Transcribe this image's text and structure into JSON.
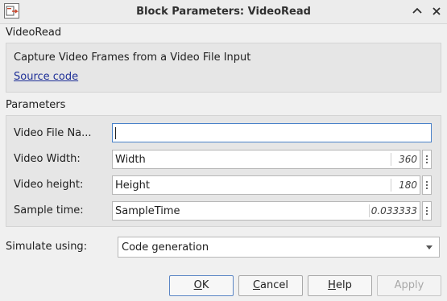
{
  "window": {
    "title": "Block Parameters: VideoRead"
  },
  "block": {
    "name": "VideoRead",
    "description": "Capture Video Frames from a Video File Input",
    "source_link": "Source code"
  },
  "parameters": {
    "heading": "Parameters",
    "rows": [
      {
        "label": "Video File Na...",
        "value": "",
        "suffix": ""
      },
      {
        "label": "Video Width:",
        "value": "Width",
        "suffix": "360"
      },
      {
        "label": "Video height:",
        "value": "Height",
        "suffix": "180"
      },
      {
        "label": "Sample time:",
        "value": "SampleTime",
        "suffix": "0.033333"
      }
    ]
  },
  "simulate": {
    "label": "Simulate using:",
    "selected": "Code generation"
  },
  "buttons": {
    "ok_first": "O",
    "ok_rest": "K",
    "cancel_first": "C",
    "cancel_rest": "ancel",
    "help_first": "H",
    "help_rest": "elp",
    "apply": "Apply"
  },
  "colors": {
    "link": "#1e2f97",
    "focus_border": "#4a82c9",
    "default_button_border": "#5b86c5"
  },
  "icons": [
    "simulink-block-icon",
    "chevron-up-icon",
    "close-icon",
    "more-options-icon",
    "chevron-down-icon"
  ]
}
